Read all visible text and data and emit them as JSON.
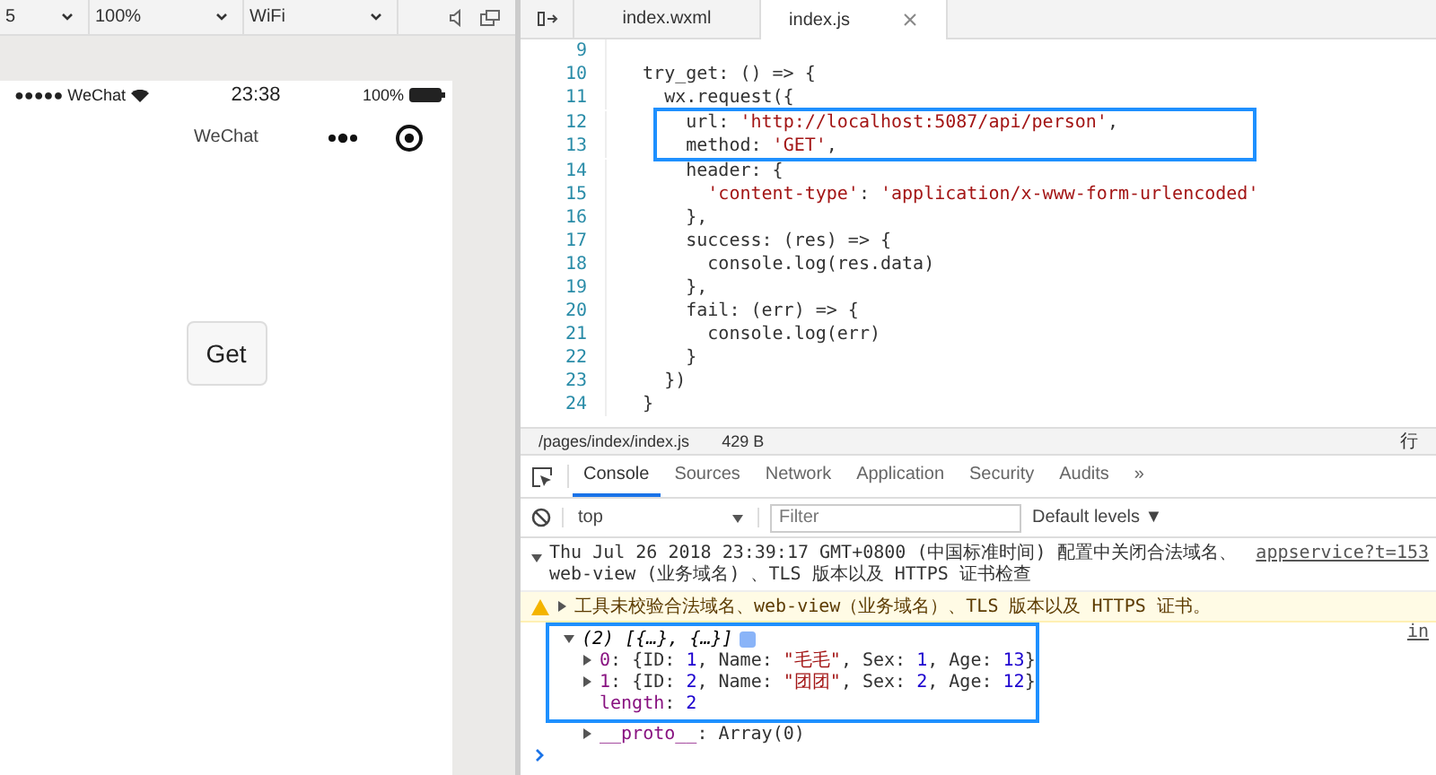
{
  "sim_toolbar": {
    "selects": [
      "5",
      "100%",
      "WiFi"
    ]
  },
  "phone": {
    "carrier": "●●●●● WeChat",
    "time": "23:38",
    "battery": "100%",
    "nav_title": "WeChat",
    "button": "Get"
  },
  "editor": {
    "tabs": [
      {
        "label": "index.wxml",
        "selected": false
      },
      {
        "label": "index.js",
        "selected": true
      }
    ],
    "lines": [
      {
        "number": "9",
        "highlighted": false
      },
      {
        "number": "10",
        "highlighted": false,
        "segments": [
          {
            "text": "  try_get: () => {",
            "kind": "plain"
          }
        ]
      },
      {
        "number": "11",
        "highlighted": false,
        "segments": [
          {
            "text": "    wx.request({",
            "kind": "plain"
          }
        ]
      },
      {
        "number": "12",
        "highlighted": true,
        "segments": [
          {
            "text": "      url: ",
            "kind": "plain"
          },
          {
            "text": "'http://localhost:5087/api/person'",
            "kind": "string"
          },
          {
            "text": ",",
            "kind": "plain"
          }
        ]
      },
      {
        "number": "13",
        "highlighted": true,
        "segments": [
          {
            "text": "      method: ",
            "kind": "plain"
          },
          {
            "text": "'GET'",
            "kind": "string"
          },
          {
            "text": ",",
            "kind": "plain"
          }
        ]
      },
      {
        "number": "14",
        "highlighted": false,
        "segments": [
          {
            "text": "      header: {",
            "kind": "plain"
          }
        ]
      },
      {
        "number": "15",
        "highlighted": false,
        "segments": [
          {
            "text": "        'content-type'",
            "kind": "string"
          },
          {
            "text": ": ",
            "kind": "plain"
          },
          {
            "text": "'application/x-www-form-urlencoded'",
            "kind": "string"
          }
        ]
      },
      {
        "number": "16",
        "highlighted": false,
        "segments": [
          {
            "text": "      },",
            "kind": "plain"
          }
        ]
      },
      {
        "number": "17",
        "highlighted": false,
        "segments": [
          {
            "text": "      success: (res) => {",
            "kind": "plain"
          }
        ]
      },
      {
        "number": "18",
        "highlighted": false,
        "segments": [
          {
            "text": "        console.log(res.data)",
            "kind": "plain"
          }
        ]
      },
      {
        "number": "19",
        "highlighted": false,
        "segments": [
          {
            "text": "      },",
            "kind": "plain"
          }
        ]
      },
      {
        "number": "20",
        "highlighted": false,
        "segments": [
          {
            "text": "      fail: (err) => {",
            "kind": "plain"
          }
        ]
      },
      {
        "number": "21",
        "highlighted": false,
        "segments": [
          {
            "text": "        console.log(err)",
            "kind": "plain"
          }
        ]
      },
      {
        "number": "22",
        "highlighted": false,
        "segments": [
          {
            "text": "      }",
            "kind": "plain"
          }
        ]
      },
      {
        "number": "23",
        "highlighted": false,
        "segments": [
          {
            "text": "    })",
            "kind": "plain"
          }
        ]
      },
      {
        "number": "24",
        "highlighted": false,
        "segments": [
          {
            "text": "  }",
            "kind": "plain"
          }
        ]
      }
    ]
  },
  "file_status": {
    "path": "/pages/index/index.js",
    "size": "429 B",
    "right": "行"
  },
  "devtools": {
    "tabs": [
      {
        "label": "Console",
        "selected": true
      },
      {
        "label": "Sources",
        "selected": false
      },
      {
        "label": "Network",
        "selected": false
      },
      {
        "label": "Application",
        "selected": false
      },
      {
        "label": "Security",
        "selected": false
      },
      {
        "label": "Audits",
        "selected": false
      }
    ],
    "more": "»",
    "context": "top",
    "filter_placeholder": "Filter",
    "levels": "Default levels ▼"
  },
  "console": {
    "message": "Thu Jul 26 2018 23:39:17 GMT+0800 (中国标准时间) 配置中关闭合法域名、web-view (业务域名) 、TLS 版本以及 HTTPS 证书检查",
    "message_source": "appservice?t=153",
    "warning": "工具未校验合法域名、web-view（业务域名）、TLS 版本以及 HTTPS 证书。",
    "result_summary": "(2) [{…}, {…}]",
    "result_source": "in",
    "entries": [
      {
        "highlighted": true,
        "expandable": true,
        "segments": [
          {
            "text": "0",
            "kind": "key"
          },
          {
            "text": ": {ID: ",
            "kind": "plain"
          },
          {
            "text": "1",
            "kind": "number"
          },
          {
            "text": ", Name: ",
            "kind": "plain"
          },
          {
            "text": "\"毛毛\"",
            "kind": "string"
          },
          {
            "text": ", Sex: ",
            "kind": "plain"
          },
          {
            "text": "1",
            "kind": "number"
          },
          {
            "text": ", Age: ",
            "kind": "plain"
          },
          {
            "text": "13",
            "kind": "number"
          },
          {
            "text": "}",
            "kind": "plain"
          }
        ]
      },
      {
        "highlighted": true,
        "expandable": true,
        "segments": [
          {
            "text": "1",
            "kind": "key"
          },
          {
            "text": ": {ID: ",
            "kind": "plain"
          },
          {
            "text": "2",
            "kind": "number"
          },
          {
            "text": ", Name: ",
            "kind": "plain"
          },
          {
            "text": "\"团团\"",
            "kind": "string"
          },
          {
            "text": ", Sex: ",
            "kind": "plain"
          },
          {
            "text": "2",
            "kind": "number"
          },
          {
            "text": ", Age: ",
            "kind": "plain"
          },
          {
            "text": "12",
            "kind": "number"
          },
          {
            "text": "}",
            "kind": "plain"
          }
        ]
      },
      {
        "highlighted": true,
        "expandable": false,
        "segments": [
          {
            "text": "length",
            "kind": "key"
          },
          {
            "text": ": ",
            "kind": "plain"
          },
          {
            "text": "2",
            "kind": "number"
          }
        ]
      },
      {
        "highlighted": false,
        "expandable": true,
        "segments": [
          {
            "text": "__proto__",
            "kind": "key"
          },
          {
            "text": ": Array(0)",
            "kind": "plain"
          }
        ]
      }
    ]
  }
}
